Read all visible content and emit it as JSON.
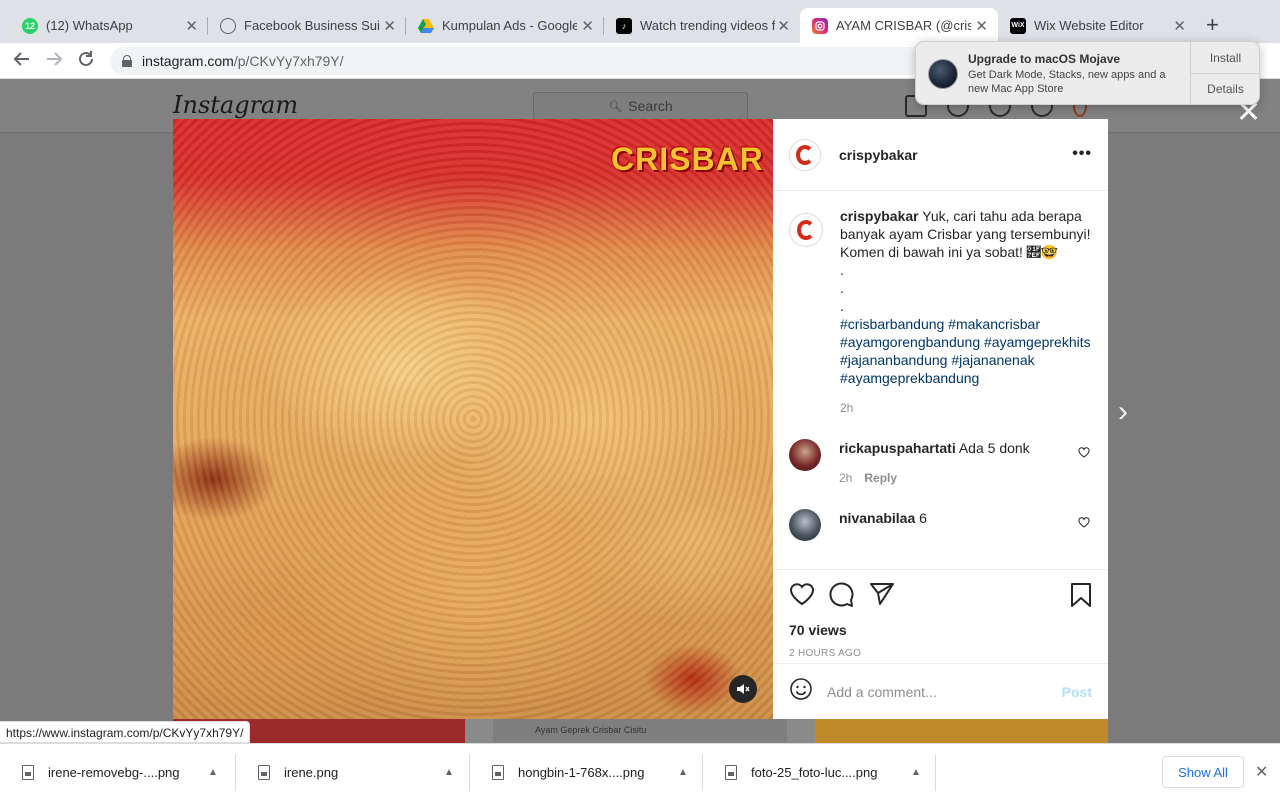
{
  "browser": {
    "tabs": [
      {
        "title": "(12) WhatsApp",
        "favicon": "whatsapp-icon",
        "badge": "12",
        "color": "#25d366",
        "active": false
      },
      {
        "title": "Facebook Business Suite",
        "favicon": "facebook-business-icon",
        "color": "#5f6368",
        "active": false
      },
      {
        "title": "Kumpulan Ads - Google Drive",
        "favicon": "google-drive-icon",
        "color": "#4285f4",
        "active": false
      },
      {
        "title": "Watch trending videos for you",
        "favicon": "tiktok-icon",
        "color": "#000000",
        "active": false
      },
      {
        "title": "AYAM CRISBAR (@crispybakar)",
        "favicon": "instagram-icon",
        "color": "#d6249f",
        "active": true
      },
      {
        "title": "Wix Website Editor",
        "favicon": "wix-icon",
        "badge": "WiX",
        "color": "#000000",
        "active": false
      }
    ],
    "url_host": "instagram.com",
    "url_path": "/p/CKvYy7xh79Y/",
    "status_url": "https://www.instagram.com/p/CKvYy7xh79Y/"
  },
  "notification": {
    "title": "Upgrade to macOS Mojave",
    "text": "Get Dark Mode, Stacks, new apps and a new Mac App Store",
    "install_label": "Install",
    "details_label": "Details"
  },
  "instagram": {
    "logo_text": "Instagram",
    "search_placeholder": "Search",
    "brand_overlay": "CRISBAR",
    "below_strip_text": "Ayam Geprek Crisbar Cisitu",
    "post": {
      "username": "crispybakar",
      "caption": "Yuk, cari tahu ada berapa banyak ayam Crisbar yang tersembunyi! Komen di bawah ini ya sobat! 🟯🤓",
      "caption_dots": ".\n.\n.",
      "hashtags": "#crisbarbandung #makancrisbar #ayamgorengbandung #ayamgeprekhits #jajananbandung #jajananenak #ayamgeprekbandung",
      "time": "2h",
      "views": "70 views",
      "posted_ago": "2 HOURS AGO",
      "comment_placeholder": "Add a comment...",
      "post_label": "Post"
    },
    "comments": [
      {
        "user": "rickapuspahartati",
        "text": "Ada 5 donk",
        "time": "2h",
        "reply_label": "Reply"
      },
      {
        "user": "nivanabilaa",
        "text": "6"
      }
    ]
  },
  "downloads": {
    "items": [
      "irene-removebg-....png",
      "irene.png",
      "hongbin-1-768x....png",
      "foto-25_foto-luc....png"
    ],
    "show_all_label": "Show All"
  }
}
